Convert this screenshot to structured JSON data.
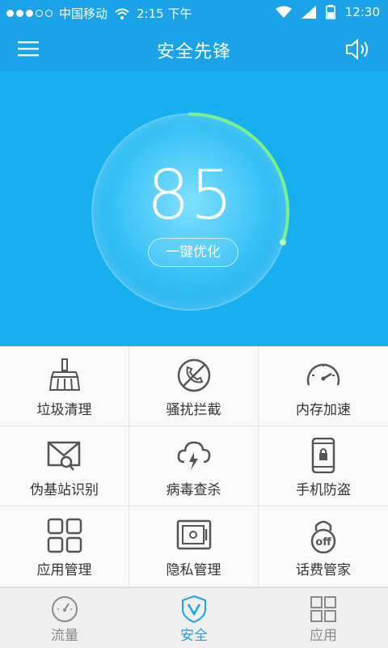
{
  "status_bar": {
    "carrier": "中国移动",
    "clock_left": "2:15 下午",
    "clock_right": "12:30"
  },
  "header": {
    "title": "安全先锋"
  },
  "hero": {
    "score": "85",
    "optimize_button": "一键优化",
    "ring_progress": 0.3
  },
  "grid": {
    "items": [
      {
        "label": "垃圾清理",
        "icon": "broom-icon"
      },
      {
        "label": "骚扰拦截",
        "icon": "blocked-phone-icon"
      },
      {
        "label": "内存加速",
        "icon": "speedometer-icon"
      },
      {
        "label": "伪基站识别",
        "icon": "envelope-search-icon"
      },
      {
        "label": "病毒查杀",
        "icon": "cloud-lightning-icon"
      },
      {
        "label": "手机防盗",
        "icon": "phone-lock-icon"
      },
      {
        "label": "应用管理",
        "icon": "app-grid-icon"
      },
      {
        "label": "隐私管理",
        "icon": "safe-icon"
      },
      {
        "label": "话费管家",
        "icon": "off-lock-icon"
      }
    ]
  },
  "tabs": [
    {
      "label": "流量",
      "icon": "gauge-icon",
      "active": false
    },
    {
      "label": "安全",
      "icon": "shield-icon",
      "active": true
    },
    {
      "label": "应用",
      "icon": "apps-icon",
      "active": false
    }
  ],
  "colors": {
    "accent": "#1aa3e8",
    "hero_bg": "#18aff0",
    "ring_green": "#7cf08a"
  }
}
